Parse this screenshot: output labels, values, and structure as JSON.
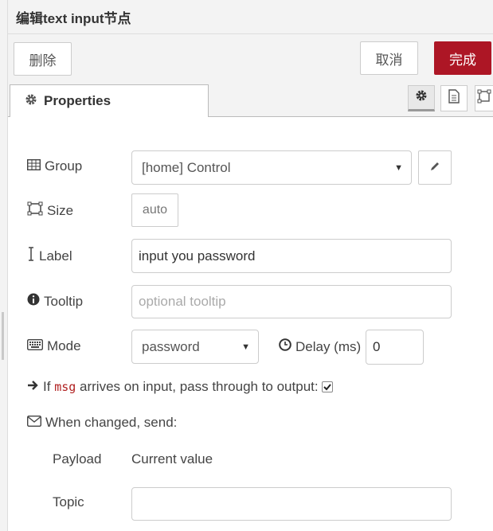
{
  "header": {
    "title": "编辑text input节点"
  },
  "toolbar": {
    "delete_label": "删除",
    "cancel_label": "取消",
    "done_label": "完成"
  },
  "tabs": [
    {
      "label": "Properties",
      "icon": "gear-icon",
      "active": true
    }
  ],
  "tab_icons": [
    "gear-icon",
    "document-icon",
    "frame-icon"
  ],
  "form": {
    "group": {
      "label": "Group",
      "value": "[home] Control"
    },
    "size": {
      "label": "Size",
      "value": "auto"
    },
    "label": {
      "label": "Label",
      "value": "input you password"
    },
    "tooltip": {
      "label": "Tooltip",
      "placeholder": "optional tooltip"
    },
    "mode": {
      "label": "Mode",
      "value": "password"
    },
    "delay": {
      "label": "Delay (ms)",
      "value": "0"
    },
    "passthrough": {
      "prefix": "If",
      "code": "msg",
      "suffix": "arrives on input, pass through to output:",
      "checked": true
    },
    "send": {
      "label": "When changed, send:"
    },
    "payload": {
      "label": "Payload",
      "value": "Current value"
    },
    "topic": {
      "label": "Topic",
      "value": ""
    }
  },
  "colors": {
    "primary": "#ad1625",
    "code": "#b02020"
  }
}
